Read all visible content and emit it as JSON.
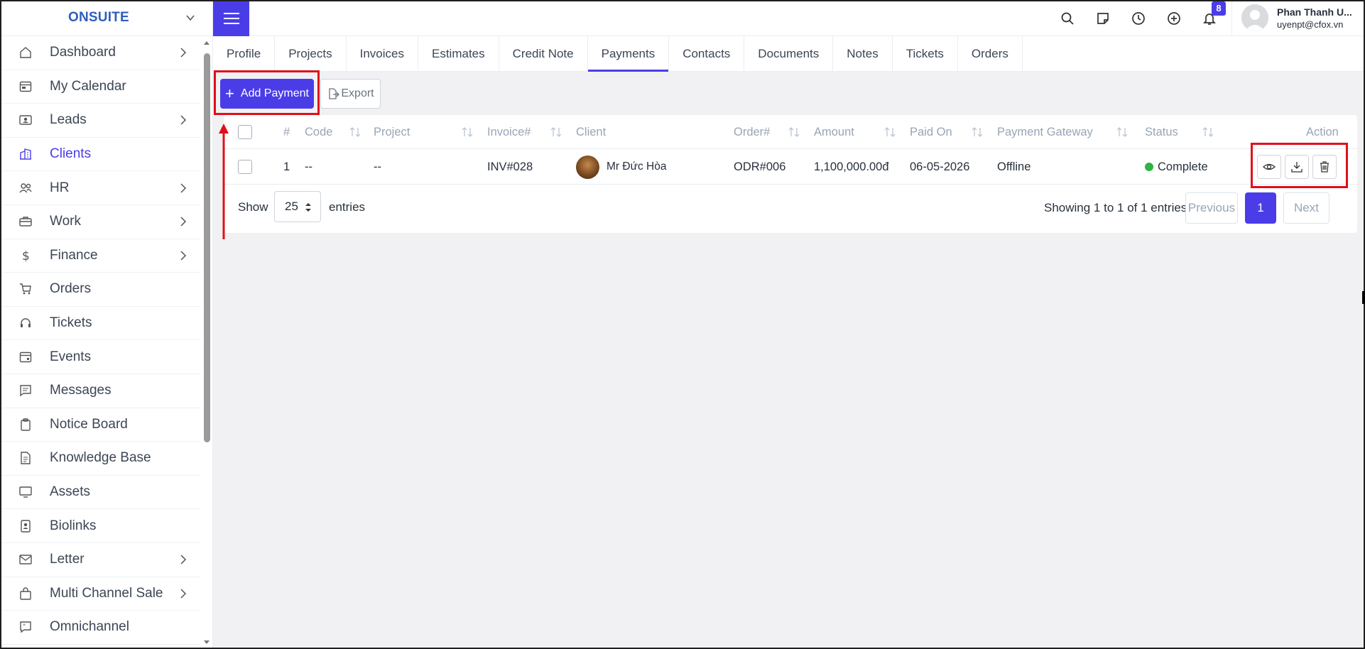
{
  "brand": {
    "name": "ONSUITE"
  },
  "sidebar": {
    "items": [
      {
        "label": "Dashboard",
        "icon": "home-icon",
        "has_arrow": true,
        "active": false
      },
      {
        "label": "My Calendar",
        "icon": "calendar-icon",
        "has_arrow": false,
        "active": false
      },
      {
        "label": "Leads",
        "icon": "id-card-icon",
        "has_arrow": true,
        "active": false
      },
      {
        "label": "Clients",
        "icon": "building-icon",
        "has_arrow": false,
        "active": true
      },
      {
        "label": "HR",
        "icon": "people-icon",
        "has_arrow": true,
        "active": false
      },
      {
        "label": "Work",
        "icon": "briefcase-icon",
        "has_arrow": true,
        "active": false
      },
      {
        "label": "Finance",
        "icon": "dollar-icon",
        "has_arrow": true,
        "active": false
      },
      {
        "label": "Orders",
        "icon": "cart-icon",
        "has_arrow": false,
        "active": false
      },
      {
        "label": "Tickets",
        "icon": "headset-icon",
        "has_arrow": false,
        "active": false
      },
      {
        "label": "Events",
        "icon": "calendar-event-icon",
        "has_arrow": false,
        "active": false
      },
      {
        "label": "Messages",
        "icon": "chat-icon",
        "has_arrow": false,
        "active": false
      },
      {
        "label": "Notice Board",
        "icon": "clipboard-icon",
        "has_arrow": false,
        "active": false
      },
      {
        "label": "Knowledge Base",
        "icon": "document-icon",
        "has_arrow": false,
        "active": false
      },
      {
        "label": "Assets",
        "icon": "monitor-icon",
        "has_arrow": false,
        "active": false
      },
      {
        "label": "Biolinks",
        "icon": "badge-icon",
        "has_arrow": false,
        "active": false
      },
      {
        "label": "Letter",
        "icon": "envelope-icon",
        "has_arrow": true,
        "active": false
      },
      {
        "label": "Multi Channel Sale",
        "icon": "bag-icon",
        "has_arrow": true,
        "active": false
      },
      {
        "label": "Omnichannel",
        "icon": "quote-icon",
        "has_arrow": false,
        "active": false
      }
    ]
  },
  "topbar": {
    "notification_count": "8",
    "user_name": "Phan Thanh U...",
    "user_email": "uyenpt@cfox.vn"
  },
  "tabs": [
    "Profile",
    "Projects",
    "Invoices",
    "Estimates",
    "Credit Note",
    "Payments",
    "Contacts",
    "Documents",
    "Notes",
    "Tickets",
    "Orders"
  ],
  "active_tab": "Payments",
  "actions": {
    "add_payment": "Add Payment",
    "export": "Export"
  },
  "table": {
    "headers": {
      "num": "#",
      "code": "Code",
      "project": "Project",
      "invoice": "Invoice#",
      "client": "Client",
      "order": "Order#",
      "amount": "Amount",
      "paid_on": "Paid On",
      "gateway": "Payment Gateway",
      "status": "Status",
      "action": "Action"
    },
    "rows": [
      {
        "num": "1",
        "code": "--",
        "project": "--",
        "invoice": "INV#028",
        "client": "Mr Đức Hòa",
        "order": "ODR#006",
        "amount": "1,100,000.00đ",
        "paid_on": "06-05-2026",
        "gateway": "Offline",
        "status": "Complete"
      }
    ]
  },
  "footer": {
    "show": "Show",
    "page_size": "25",
    "entries": "entries",
    "showing": "Showing 1 to 1 of 1 entries",
    "previous": "Previous",
    "page": "1",
    "next": "Next"
  },
  "colors": {
    "accent": "#4a3de8",
    "highlight": "#e00f1a",
    "status_complete": "#2fb344"
  }
}
